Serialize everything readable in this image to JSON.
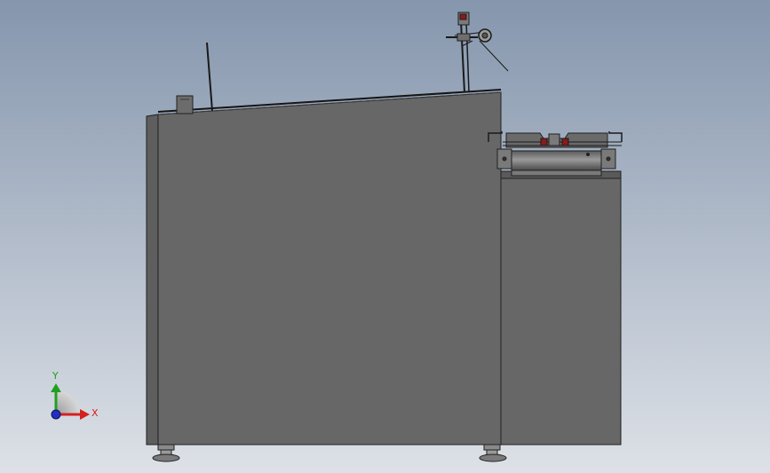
{
  "viewport": {
    "background_top": "#8596ad",
    "background_bottom": "#dde1e7"
  },
  "model": {
    "body_color": "#676767",
    "edge_color": "#202020",
    "accent_red": "#8b1a1a"
  },
  "triad": {
    "x_label": "X",
    "y_label": "Y",
    "x_color": "#d62020",
    "y_color": "#20a020",
    "z_color": "#2030c0"
  }
}
